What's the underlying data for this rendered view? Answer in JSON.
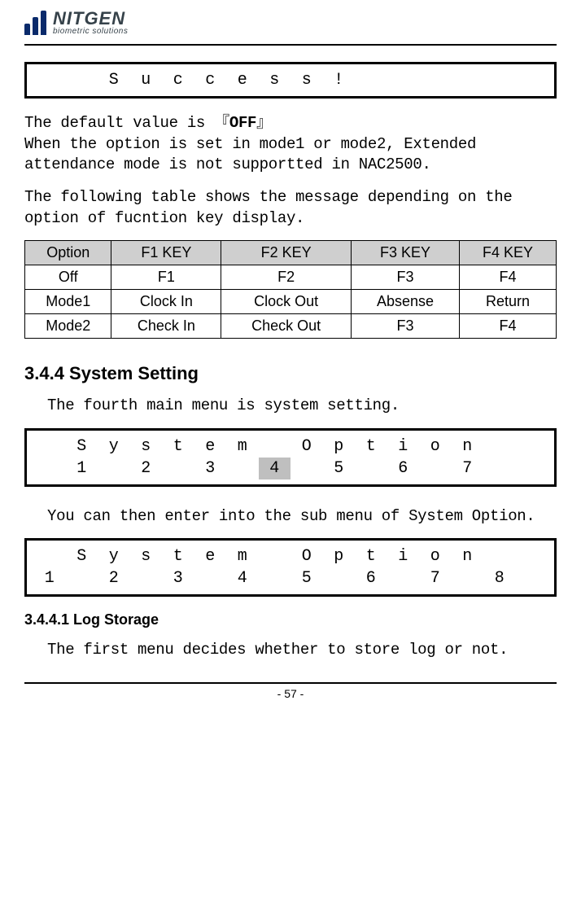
{
  "logo": {
    "brand": "NITGEN",
    "tagline": "biometric solutions"
  },
  "lcd1": {
    "rows": [
      [
        " ",
        " ",
        "S",
        "u",
        "c",
        "c",
        "e",
        "s",
        "s",
        "!",
        " ",
        " ",
        " ",
        " ",
        " ",
        " "
      ]
    ],
    "highlights": [
      []
    ]
  },
  "para1a": "The default value is 『",
  "para1a_bold": "OFF",
  "para1a_tail": "』",
  "para1b": "When the option is set in mode1 or mode2, Extended attendance mode is not supportted in NAC2500.",
  "para2": "The following table shows the message depending on the option of fucntion key display.",
  "table": {
    "headers": [
      "Option",
      "F1 KEY",
      "F2 KEY",
      "F3 KEY",
      "F4 KEY"
    ],
    "rows": [
      [
        "Off",
        "F1",
        "F2",
        "F3",
        "F4"
      ],
      [
        "Mode1",
        "Clock In",
        "Clock Out",
        "Absense",
        "Return"
      ],
      [
        "Mode2",
        "Check In",
        "Check Out",
        "F3",
        "F4"
      ]
    ]
  },
  "section_heading": "3.4.4 System Setting",
  "para3": "The fourth main menu is system setting.",
  "lcd2": {
    "rows": [
      [
        " ",
        "S",
        "y",
        "s",
        "t",
        "e",
        "m",
        " ",
        "O",
        "p",
        "t",
        "i",
        "o",
        "n",
        " ",
        " "
      ],
      [
        " ",
        "1",
        " ",
        "2",
        " ",
        "3",
        " ",
        "4",
        " ",
        "5",
        " ",
        "6",
        " ",
        "7",
        " ",
        " "
      ]
    ],
    "highlights": [
      [],
      [
        7
      ]
    ]
  },
  "para4": "You can then enter into the sub menu of System Option.",
  "lcd3": {
    "rows": [
      [
        " ",
        "S",
        "y",
        "s",
        "t",
        "e",
        "m",
        " ",
        "O",
        "p",
        "t",
        "i",
        "o",
        "n",
        " ",
        " "
      ],
      [
        "1",
        " ",
        "2",
        " ",
        "3",
        " ",
        "4",
        " ",
        "5",
        " ",
        "6",
        " ",
        "7",
        " ",
        "8",
        " "
      ]
    ],
    "highlights": [
      [],
      []
    ]
  },
  "subsection_heading": "3.4.4.1 Log Storage",
  "para5": "The first menu decides whether to store log or not.",
  "page_number": "- 57 -"
}
